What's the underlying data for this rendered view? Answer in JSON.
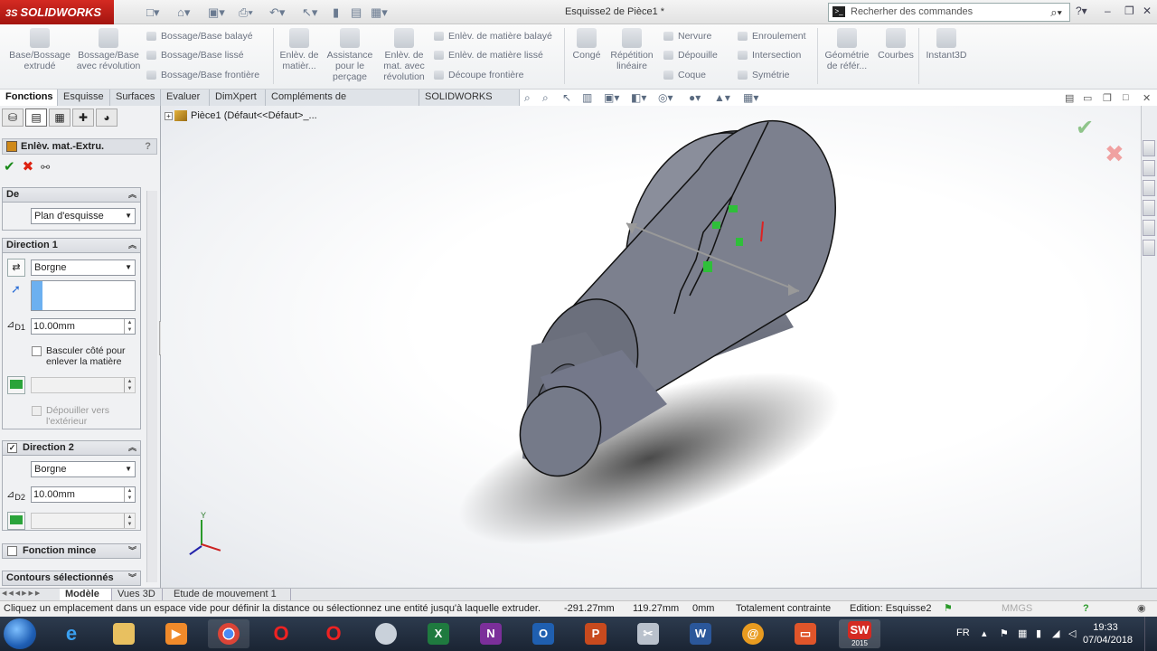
{
  "app": {
    "logo_text": "SOLIDWORKS",
    "logo_prefix": "3S",
    "window_title": "Esquisse2 de Pièce1 *"
  },
  "search": {
    "placeholder": "Recherher des commandes"
  },
  "ribbon": {
    "big": [
      "Base/Bossage extrudé",
      "Bossage/Base avec révolution",
      "Enlèv. de matièr...",
      "Assistance pour le perçage",
      "Enlèv. de mat. avec révolution",
      "Congé",
      "Répétition linéaire",
      "Géométrie de référ...",
      "Courbes",
      "Instant3D"
    ],
    "small": [
      "Bossage/Base balayé",
      "Bossage/Base lissé",
      "Bossage/Base frontière",
      "Enlèv. de matière balayé",
      "Enlèv. de matière lissé",
      "Découpe frontière",
      "Nervure",
      "Dépouille",
      "Coque",
      "Enroulement",
      "Intersection",
      "Symétrie"
    ]
  },
  "tabs": [
    "Fonctions",
    "Esquisse",
    "Surfaces",
    "Evaluer",
    "DimXpert",
    "Compléments de SOLIDWORKS",
    "SOLIDWORKS MBD"
  ],
  "panel": {
    "title": "Enlèv. mat.-Extru.",
    "help": "?",
    "de": {
      "label": "De",
      "value": "Plan d'esquisse"
    },
    "dir1": {
      "label": "Direction 1",
      "type": "Borgne",
      "depth": "10.00mm",
      "flip_label": "Basculer côté pour enlever la matière",
      "draft_label": "Dépouiller vers l'extérieur"
    },
    "dir2": {
      "label": "Direction 2",
      "type": "Borgne",
      "depth": "10.00mm"
    },
    "thin": {
      "label": "Fonction mince"
    },
    "contours": {
      "label": "Contours sélectionnés"
    },
    "d1": "D1",
    "d2": "D2"
  },
  "tree": {
    "root": "Pièce1  (Défaut<<Défaut>_..."
  },
  "bottom_tabs": [
    "Modèle",
    "Vues 3D",
    "Etude de mouvement 1"
  ],
  "status": {
    "message": "Cliquez un emplacement dans un espace vide pour définir la distance ou sélectionnez une entité jusqu'à laquelle extruder.",
    "x": "-291.27mm",
    "y": "119.27mm",
    "z": "0mm",
    "constraint": "Totalement contrainte",
    "edition": "Edition: Esquisse2",
    "units": "MMGS"
  },
  "taskbar": {
    "lang": "FR",
    "time": "19:33",
    "date": "07/04/2018",
    "sw_badge": "2015"
  }
}
